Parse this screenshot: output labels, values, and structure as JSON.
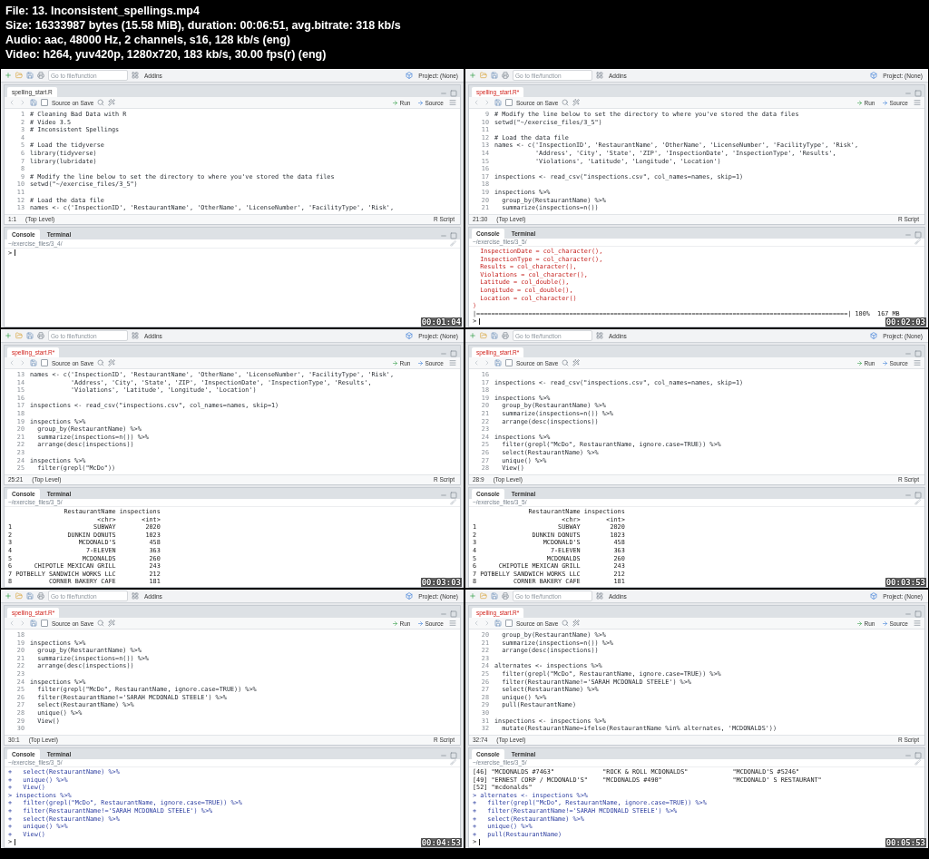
{
  "file_info": [
    "File: 13. Inconsistent_spellings.mp4",
    "Size: 16333987 bytes (15.58 MiB), duration: 00:06:51, avg.bitrate: 318 kb/s",
    "Audio: aac, 48000 Hz, 2 channels, s16, 128 kb/s (eng)",
    "Video: h264, yuv420p, 1280x720, 183 kb/s, 30.00 fps(r) (eng)"
  ],
  "frames": [
    {
      "toolbar": {
        "search_placeholder": "Go to file/function",
        "addins": "Addins",
        "project": "Project: (None)"
      },
      "tab": {
        "label": "spelling_start.R",
        "modified": false
      },
      "editor_toolbar": {
        "source_on_save": "Source on Save",
        "checked": false,
        "run": "Run",
        "source": "Source"
      },
      "code": [
        {
          "n": "1",
          "text": "# Cleaning Bad Data with R"
        },
        {
          "n": "2",
          "text": "# Video 3.5"
        },
        {
          "n": "3",
          "text": "# Inconsistent Spellings"
        },
        {
          "n": "4"
        },
        {
          "n": "5",
          "text": "# Load the tidyverse"
        },
        {
          "n": "6",
          "text": "library(tidyverse)"
        },
        {
          "n": "7",
          "text": "library(lubridate)"
        },
        {
          "n": "8"
        },
        {
          "n": "9",
          "text": "# Modify the line below to set the directory to where you've stored the data files"
        },
        {
          "n": "10",
          "text": "setwd(\"~/exercise_files/3_5\")"
        },
        {
          "n": "11"
        },
        {
          "n": "12",
          "text": "# Load the data file"
        },
        {
          "n": "13",
          "text": "names <- c('InspectionID', 'RestaurantName', 'OtherName', 'LicenseNumber', 'FacilityType', 'Risk',"
        }
      ],
      "status": {
        "position": "1:1",
        "scope": "(Top Level)",
        "file_type": "R Script"
      },
      "console_tabs": [
        {
          "label": "Console",
          "selected": true
        },
        {
          "label": "Terminal",
          "selected": false
        }
      ],
      "console_path": "~/exercise_files/3_4/",
      "console": [
        {
          "kind": "prompt",
          "text": ">"
        }
      ],
      "timestamp": "00:01:04"
    },
    {
      "toolbar": {
        "search_placeholder": "Go to file/function",
        "addins": "Addins",
        "project": "Project: (None)"
      },
      "tab": {
        "label": "spelling_start.R*",
        "modified": true
      },
      "editor_toolbar": {
        "source_on_save": "Source on Save",
        "checked": false,
        "run": "Run",
        "source": "Source"
      },
      "code": [
        {
          "n": "9",
          "text": "# Modify the line below to set the directory to where you've stored the data files"
        },
        {
          "n": "10",
          "text": "setwd(\"~/exercise_files/3_5\")"
        },
        {
          "n": "11"
        },
        {
          "n": "12",
          "text": "# Load the data file"
        },
        {
          "n": "13",
          "text": "names <- c('InspectionID', 'RestaurantName', 'OtherName', 'LicenseNumber', 'FacilityType', 'Risk',"
        },
        {
          "n": "14",
          "text": "           'Address', 'City', 'State', 'ZIP', 'InspectionDate', 'InspectionType', 'Results',"
        },
        {
          "n": "15",
          "text": "           'Violations', 'Latitude', 'Longitude', 'Location')"
        },
        {
          "n": "16"
        },
        {
          "n": "17",
          "text": "inspections <- read_csv(\"inspections.csv\", col_names=names, skip=1)"
        },
        {
          "n": "18"
        },
        {
          "n": "19",
          "text": "inspections %>%"
        },
        {
          "n": "20",
          "text": "  group_by(RestaurantName) %>%"
        },
        {
          "n": "21",
          "text": "  summarize(inspections=n())"
        }
      ],
      "status": {
        "position": "21:30",
        "scope": "(Top Level)",
        "file_type": "R Script"
      },
      "console_tabs": [
        {
          "label": "Console",
          "selected": true
        },
        {
          "label": "Terminal",
          "selected": false
        }
      ],
      "console_path": "~/exercise_files/3_5/",
      "console": [
        {
          "kind": "message",
          "text": "  InspectionDate = col_character(),"
        },
        {
          "kind": "message",
          "text": "  InspectionType = col_character(),"
        },
        {
          "kind": "message",
          "text": "  Results = col_character(),"
        },
        {
          "kind": "message",
          "text": "  Violations = col_character(),"
        },
        {
          "kind": "message",
          "text": "  Latitude = col_double(),"
        },
        {
          "kind": "message",
          "text": "  Longitude = col_double(),"
        },
        {
          "kind": "message",
          "text": "  Location = col_character()"
        },
        {
          "kind": "message",
          "text": ")"
        },
        {
          "kind": "output",
          "text": "|====================================================================================================| 100%  167 MB"
        },
        {
          "kind": "prompt",
          "text": ">"
        }
      ],
      "timestamp": "00:02:03"
    },
    {
      "toolbar": {
        "search_placeholder": "Go to file/function",
        "addins": "Addins",
        "project": "Project: (None)"
      },
      "tab": {
        "label": "spelling_start.R*",
        "modified": true
      },
      "editor_toolbar": {
        "source_on_save": "Source on Save",
        "checked": false,
        "run": "Run",
        "source": "Source"
      },
      "code": [
        {
          "n": "13",
          "text": "names <- c('InspectionID', 'RestaurantName', 'OtherName', 'LicenseNumber', 'FacilityType', 'Risk',"
        },
        {
          "n": "14",
          "text": "           'Address', 'City', 'State', 'ZIP', 'InspectionDate', 'InspectionType', 'Results',"
        },
        {
          "n": "15",
          "text": "           'Violations', 'Latitude', 'Longitude', 'Location')"
        },
        {
          "n": "16"
        },
        {
          "n": "17",
          "text": "inspections <- read_csv(\"inspections.csv\", col_names=names, skip=1)"
        },
        {
          "n": "18"
        },
        {
          "n": "19",
          "text": "inspections %>%"
        },
        {
          "n": "20",
          "text": "  group_by(RestaurantName) %>%"
        },
        {
          "n": "21",
          "text": "  summarize(inspections=n()) %>%"
        },
        {
          "n": "22",
          "text": "  arrange(desc(inspections))"
        },
        {
          "n": "23"
        },
        {
          "n": "24",
          "text": "inspections %>%"
        },
        {
          "n": "25",
          "text": "  filter(grepl(\"McDo\"))"
        }
      ],
      "status": {
        "position": "25:21",
        "scope": "(Top Level)",
        "file_type": "R Script"
      },
      "console_tabs": [
        {
          "label": "Console",
          "selected": true
        },
        {
          "label": "Terminal",
          "selected": false
        }
      ],
      "console_path": "~/exercise_files/3_5/",
      "console": [
        {
          "kind": "output",
          "text": "               RestaurantName inspections"
        },
        {
          "kind": "output",
          "text": "                        <chr>       <int>"
        },
        {
          "kind": "output",
          "text": "1                      SUBWAY        2020"
        },
        {
          "kind": "output",
          "text": "2               DUNKIN DONUTS        1023"
        },
        {
          "kind": "output",
          "text": "3                  MCDONALD'S         458"
        },
        {
          "kind": "output",
          "text": "4                    7-ELEVEN         363"
        },
        {
          "kind": "output",
          "text": "5                   MCDONALDS         260"
        },
        {
          "kind": "output",
          "text": "6      CHIPOTLE MEXICAN GRILL         243"
        },
        {
          "kind": "output",
          "text": "7 POTBELLY SANDWICH WORKS LLC         212"
        },
        {
          "kind": "output",
          "text": "8          CORNER BAKERY CAFE         181"
        }
      ],
      "timestamp": "00:03:03"
    },
    {
      "toolbar": {
        "search_placeholder": "Go to file/function",
        "addins": "Addins",
        "project": "Project: (None)"
      },
      "tab": {
        "label": "spelling_start.R*",
        "modified": true
      },
      "editor_toolbar": {
        "source_on_save": "Source on Save",
        "checked": false,
        "run": "Run",
        "source": "Source"
      },
      "code": [
        {
          "n": "16"
        },
        {
          "n": "17",
          "text": "inspections <- read_csv(\"inspections.csv\", col_names=names, skip=1)"
        },
        {
          "n": "18"
        },
        {
          "n": "19",
          "text": "inspections %>%"
        },
        {
          "n": "20",
          "text": "  group_by(RestaurantName) %>%"
        },
        {
          "n": "21",
          "text": "  summarize(inspections=n()) %>%"
        },
        {
          "n": "22",
          "text": "  arrange(desc(inspections))"
        },
        {
          "n": "23"
        },
        {
          "n": "24",
          "text": "inspections %>%"
        },
        {
          "n": "25",
          "text": "  filter(grepl(\"McDo\", RestaurantName, ignore.case=TRUE)) %>%"
        },
        {
          "n": "26",
          "text": "  select(RestaurantName) %>%"
        },
        {
          "n": "27",
          "text": "  unique() %>%"
        },
        {
          "n": "28",
          "text": "  View()"
        }
      ],
      "status": {
        "position": "28:9",
        "scope": "(Top Level)",
        "file_type": "R Script"
      },
      "console_tabs": [
        {
          "label": "Console",
          "selected": true
        },
        {
          "label": "Terminal",
          "selected": false
        }
      ],
      "console_path": "~/exercise_files/3_5/",
      "console": [
        {
          "kind": "output",
          "text": "               RestaurantName inspections"
        },
        {
          "kind": "output",
          "text": "                        <chr>       <int>"
        },
        {
          "kind": "output",
          "text": "1                      SUBWAY        2020"
        },
        {
          "kind": "output",
          "text": "2               DUNKIN DONUTS        1023"
        },
        {
          "kind": "output",
          "text": "3                  MCDONALD'S         458"
        },
        {
          "kind": "output",
          "text": "4                    7-ELEVEN         363"
        },
        {
          "kind": "output",
          "text": "5                   MCDONALDS         260"
        },
        {
          "kind": "output",
          "text": "6      CHIPOTLE MEXICAN GRILL         243"
        },
        {
          "kind": "output",
          "text": "7 POTBELLY SANDWICH WORKS LLC         212"
        },
        {
          "kind": "output",
          "text": "8          CORNER BAKERY CAFE         181"
        }
      ],
      "timestamp": "00:03:53"
    },
    {
      "toolbar": {
        "search_placeholder": "Go to file/function",
        "addins": "Addins",
        "project": "Project: (None)"
      },
      "tab": {
        "label": "spelling_start.R*",
        "modified": true
      },
      "editor_toolbar": {
        "source_on_save": "Source on Save",
        "checked": false,
        "run": "Run",
        "source": "Source"
      },
      "code": [
        {
          "n": "18"
        },
        {
          "n": "19",
          "text": "inspections %>%"
        },
        {
          "n": "20",
          "text": "  group_by(RestaurantName) %>%"
        },
        {
          "n": "21",
          "text": "  summarize(inspections=n()) %>%"
        },
        {
          "n": "22",
          "text": "  arrange(desc(inspections))"
        },
        {
          "n": "23"
        },
        {
          "n": "24",
          "text": "inspections %>%"
        },
        {
          "n": "25",
          "text": "  filter(grepl(\"McDo\", RestaurantName, ignore.case=TRUE)) %>%"
        },
        {
          "n": "26",
          "text": "  filter(RestaurantName!='SARAH MCDONALD STEELE') %>%"
        },
        {
          "n": "27",
          "text": "  select(RestaurantName) %>%"
        },
        {
          "n": "28",
          "text": "  unique() %>%"
        },
        {
          "n": "29",
          "text": "  View()"
        },
        {
          "n": "30"
        }
      ],
      "status": {
        "position": "30:1",
        "scope": "(Top Level)",
        "file_type": "R Script"
      },
      "console_tabs": [
        {
          "label": "Console",
          "selected": true
        },
        {
          "label": "Terminal",
          "selected": false
        }
      ],
      "console_path": "~/exercise_files/3_5/",
      "console": [
        {
          "kind": "input",
          "text": "+   select(RestaurantName) %>%"
        },
        {
          "kind": "input",
          "text": "+   unique() %>%"
        },
        {
          "kind": "input",
          "text": "+   View()"
        },
        {
          "kind": "input",
          "text": "> inspections %>%"
        },
        {
          "kind": "input",
          "text": "+   filter(grepl(\"McDo\", RestaurantName, ignore.case=TRUE)) %>%"
        },
        {
          "kind": "input",
          "text": "+   filter(RestaurantName!='SARAH MCDONALD STEELE') %>%"
        },
        {
          "kind": "input",
          "text": "+   select(RestaurantName) %>%"
        },
        {
          "kind": "input",
          "text": "+   unique() %>%"
        },
        {
          "kind": "input",
          "text": "+   View()"
        },
        {
          "kind": "prompt",
          "text": ">"
        }
      ],
      "timestamp": "00:04:53"
    },
    {
      "toolbar": {
        "search_placeholder": "Go to file/function",
        "addins": "Addins",
        "project": "Project: (None)"
      },
      "tab": {
        "label": "spelling_start.R*",
        "modified": true
      },
      "editor_toolbar": {
        "source_on_save": "Source on Save",
        "checked": false,
        "run": "Run",
        "source": "Source"
      },
      "code": [
        {
          "n": "20",
          "text": "  group_by(RestaurantName) %>%"
        },
        {
          "n": "21",
          "text": "  summarize(inspections=n()) %>%"
        },
        {
          "n": "22",
          "text": "  arrange(desc(inspections))"
        },
        {
          "n": "23"
        },
        {
          "n": "24",
          "text": "alternates <- inspections %>%"
        },
        {
          "n": "25",
          "text": "  filter(grepl(\"McDo\", RestaurantName, ignore.case=TRUE)) %>%"
        },
        {
          "n": "26",
          "text": "  filter(RestaurantName!='SARAH MCDONALD STEELE') %>%"
        },
        {
          "n": "27",
          "text": "  select(RestaurantName) %>%"
        },
        {
          "n": "28",
          "text": "  unique() %>%"
        },
        {
          "n": "29",
          "text": "  pull(RestaurantName)"
        },
        {
          "n": "30"
        },
        {
          "n": "31",
          "text": "inspections <- inspections %>%"
        },
        {
          "n": "32",
          "text": "  mutate(RestaurantName=ifelse(RestaurantName %in% alternates, 'MCDONALDS'))"
        }
      ],
      "status": {
        "position": "32:74",
        "scope": "(Top Level)",
        "file_type": "R Script"
      },
      "console_tabs": [
        {
          "label": "Console",
          "selected": true
        },
        {
          "label": "Terminal",
          "selected": false
        }
      ],
      "console_path": "~/exercise_files/3_5/",
      "console": [
        {
          "kind": "output",
          "text": "[46] \"MCDONALDS #7463\"             \"ROCK & ROLL MCDONALDS\"            \"MCDONALD'S #5246\""
        },
        {
          "kind": "output",
          "text": "[49] \"ERNEST CORP / MCDONALD'S\"    \"MCDONALDS #490\"                   \"MCDONALD' S RESTAURANT\""
        },
        {
          "kind": "output",
          "text": "[52] \"mcdonalds\""
        },
        {
          "kind": "input",
          "text": "> alternates <- inspections %>%"
        },
        {
          "kind": "input",
          "text": "+   filter(grepl(\"McDo\", RestaurantName, ignore.case=TRUE)) %>%"
        },
        {
          "kind": "input",
          "text": "+   filter(RestaurantName!='SARAH MCDONALD STEELE') %>%"
        },
        {
          "kind": "input",
          "text": "+   select(RestaurantName) %>%"
        },
        {
          "kind": "input",
          "text": "+   unique() %>%"
        },
        {
          "kind": "input",
          "text": "+   pull(RestaurantName)"
        },
        {
          "kind": "prompt",
          "text": ">"
        }
      ],
      "timestamp": "00:05:53"
    }
  ]
}
